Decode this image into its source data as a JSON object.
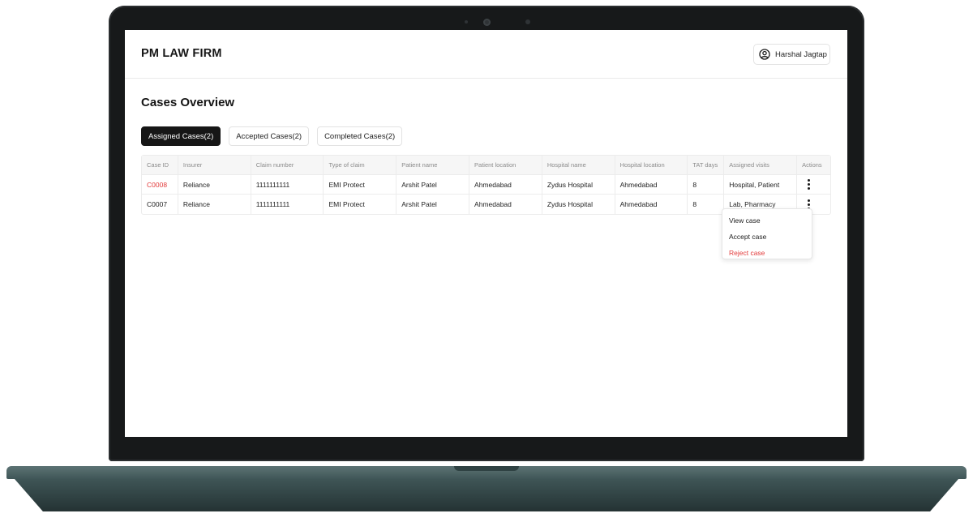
{
  "app": {
    "brand": "PM LAW FIRM"
  },
  "user": {
    "name": "Harshal Jagtap"
  },
  "page": {
    "title": "Cases Overview"
  },
  "tabs": [
    {
      "label": "Assigned Cases(2)",
      "active": true
    },
    {
      "label": "Accepted Cases(2)",
      "active": false
    },
    {
      "label": "Completed Cases(2)",
      "active": false
    }
  ],
  "table": {
    "headers": [
      "Case ID",
      "Insurer",
      "Claim number",
      "Type of claim",
      "Patient name",
      "Patient location",
      "Hospital name",
      "Hospital location",
      "TAT days",
      "Assigned visits",
      "Actions"
    ],
    "rows": [
      [
        "C0008",
        "Reliance",
        "1111111111",
        "EMI Protect",
        "Arshit Patel",
        "Ahmedabad",
        "Zydus Hospital",
        "Ahmedabad",
        "8",
        "Hospital, Patient"
      ],
      [
        "C0007",
        "Reliance",
        "1111111111",
        "EMI Protect",
        "Arshit Patel",
        "Ahmedabad",
        "Zydus Hospital",
        "Ahmedabad",
        "8",
        "Lab, Pharmacy"
      ]
    ]
  },
  "action_menu": {
    "view": "View case",
    "accept": "Accept case",
    "reject": "Reject case"
  },
  "colors": {
    "accent_red": "#e23b3b",
    "active_tab": "#161616",
    "laptop_base": "#3f5657"
  }
}
